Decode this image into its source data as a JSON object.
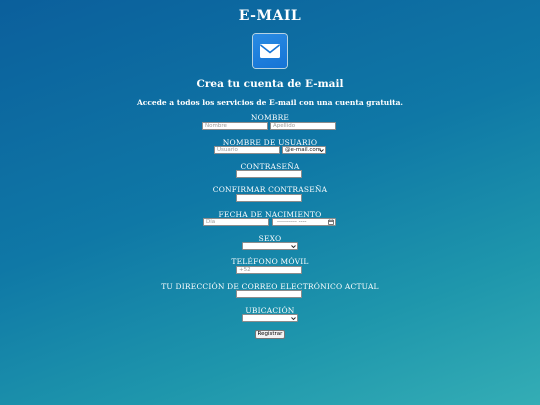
{
  "header": {
    "title": "E-MAIL",
    "logo_icon": "envelope-icon",
    "subtitle": "Crea tu cuenta de E-mail",
    "tagline": "Accede a todos los servicios de E-mail con una cuenta gratuita."
  },
  "form": {
    "name": {
      "label": "NOMBRE",
      "first_placeholder": "Nombre",
      "last_placeholder": "Apellido"
    },
    "username": {
      "label": "NOMBRE DE USUARIO",
      "placeholder": "Usuario",
      "domain_selected": "@e-mail.com"
    },
    "password": {
      "label": "CONTRASEÑA"
    },
    "confirm_password": {
      "label": "CONFIRMAR CONTRASEÑA"
    },
    "birthdate": {
      "label": "FECHA DE NACIMIENTO",
      "day_placeholder": "Día",
      "date_placeholder": "---------- ----"
    },
    "sex": {
      "label": "SEXO"
    },
    "mobile": {
      "label": "TELÉFONO MÓVIL",
      "prefix": "+52"
    },
    "current_email": {
      "label": "TU DIRECCIÓN DE CORREO ELECTRÓNICO ACTUAL"
    },
    "location": {
      "label": "UBICACIÓN"
    },
    "submit_label": "Registrar"
  },
  "colors": {
    "bg_top": "#0b5f9c",
    "bg_bottom": "#34adb5",
    "logo": "#1574d6"
  }
}
